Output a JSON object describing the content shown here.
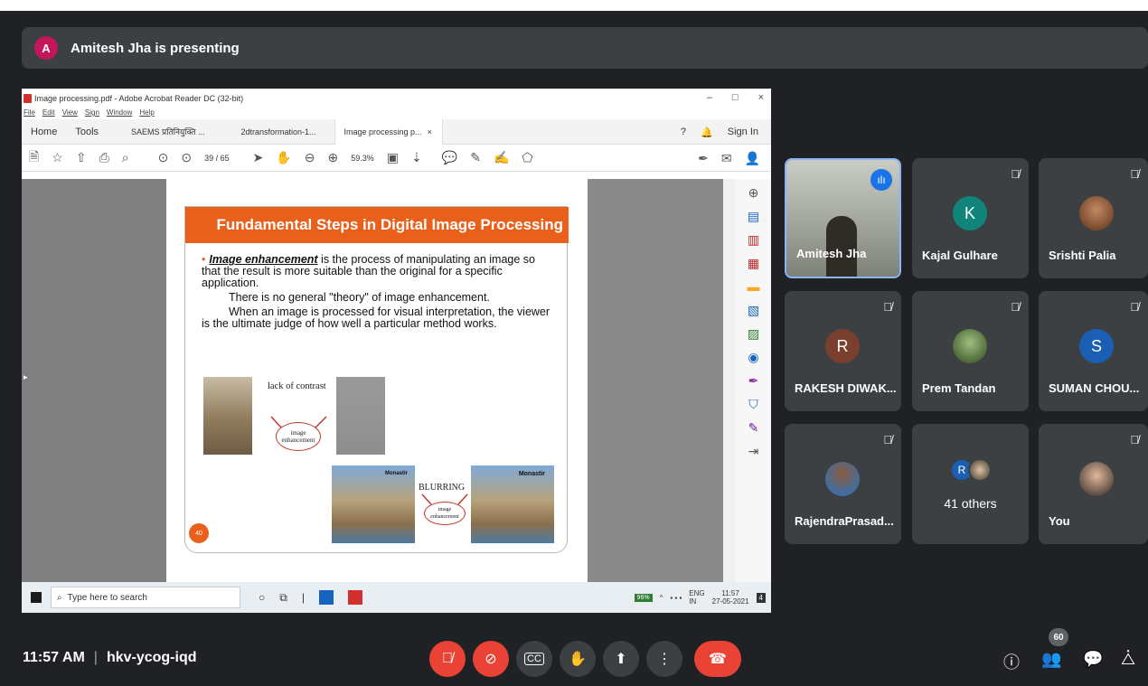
{
  "presenting_banner": {
    "avatar_letter": "A",
    "text": "Amitesh Jha is presenting"
  },
  "shared_screen": {
    "window_title": "Image processing.pdf - Adobe Acrobat Reader DC (32-bit)",
    "window_controls": [
      "–",
      "□",
      "×"
    ],
    "menu": [
      "File",
      "Edit",
      "View",
      "Sign",
      "Window",
      "Help"
    ],
    "tabs": [
      "Home",
      "Tools",
      "SAEMS प्रतिनियुक्ति ...",
      "2dtransformation-1...",
      "Image processing p..."
    ],
    "tab_close": "×",
    "help": "?",
    "sign_in": "Sign In",
    "page_number": "39",
    "page_total": "/ 65",
    "zoom": "59.3%",
    "slide": {
      "title": "Fundamental Steps in Digital Image Processing",
      "term": "Image enhancement",
      "line1_rest": " is the process of manipulating an image so that the result is more suitable than the original for a specific application.",
      "line2": "There is no general \"theory\" of image enhancement.",
      "line3": "When an image is processed for visual interpretation, the viewer is the ultimate judge of how well a particular method works.",
      "label_contrast": "lack of contrast",
      "bubble1": "image enhancement",
      "label_blurring": "BLURRING",
      "bubble2": "image enhancement",
      "img_caption1": "Monastir",
      "img_caption2": "Monastir",
      "slide_number": "40"
    },
    "taskbar": {
      "search_placeholder": "Type here to search",
      "battery": "96%",
      "lang": "ENG",
      "region": "IN",
      "time": "11:57",
      "date": "27-05-2021",
      "notif_count": "4"
    }
  },
  "participants": [
    {
      "name": "Amitesh Jha",
      "type": "video",
      "speaking": true
    },
    {
      "name": "Kajal Gulhare",
      "initial": "K",
      "color": "#12857a",
      "muted": true
    },
    {
      "name": "Srishti Palia",
      "type": "photo",
      "muted": true
    },
    {
      "name": "RAKESH DIWAK...",
      "initial": "R",
      "color": "#7b3f2e",
      "muted": true
    },
    {
      "name": "Prem Tandan",
      "type": "photo",
      "muted": true
    },
    {
      "name": "SUMAN CHOU...",
      "initial": "S",
      "color": "#1a5fb4",
      "muted": true
    },
    {
      "name": "RajendraPrasad...",
      "type": "photo",
      "muted": true
    },
    {
      "name": "41 others",
      "initial": "R",
      "color": "#1a5fb4"
    },
    {
      "name": "You",
      "type": "photo",
      "muted": true
    }
  ],
  "bottom_bar": {
    "time": "11:57 AM",
    "separator": "|",
    "meeting_code": "hkv-ycog-iqd",
    "people_count": "60"
  }
}
